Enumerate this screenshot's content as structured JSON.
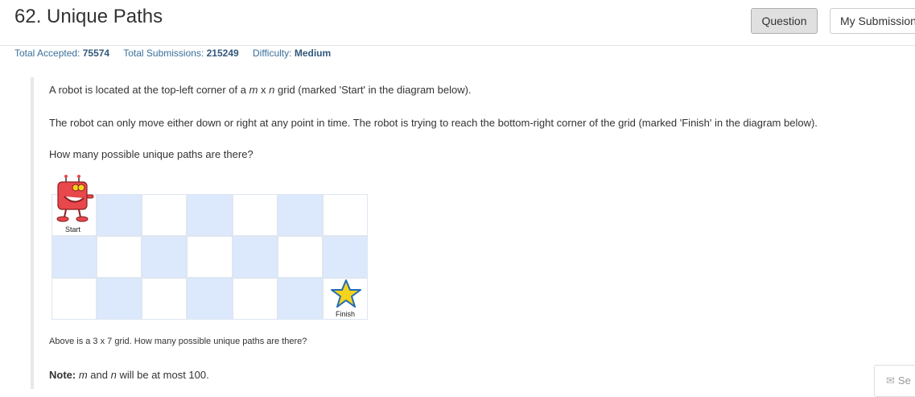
{
  "header": {
    "title": "62. Unique Paths",
    "tabs": [
      {
        "label": "Question",
        "active": true
      },
      {
        "label": "My Submissions",
        "active": false
      }
    ]
  },
  "stats": {
    "accepted_label": "Total Accepted:",
    "accepted_value": "75574",
    "submissions_label": "Total Submissions:",
    "submissions_value": "215249",
    "difficulty_label": "Difficulty:",
    "difficulty_value": "Medium"
  },
  "problem": {
    "p1_a": "A robot is located at the top-left corner of a ",
    "p1_m": "m",
    "p1_x": " x ",
    "p1_n": "n",
    "p1_b": " grid (marked 'Start' in the diagram below).",
    "p2": "The robot can only move either down or right at any point in time. The robot is trying to reach the bottom-right corner of the grid (marked 'Finish' in the diagram below).",
    "p3": "How many possible unique paths are there?",
    "caption": "Above is a 3 x 7 grid. How many possible unique paths are there?",
    "note_label": "Note:",
    "note_m": "m",
    "note_and": " and ",
    "note_n": "n",
    "note_rest": " will be at most 100."
  },
  "diagram": {
    "rows": 3,
    "cols": 7,
    "start_label": "Start",
    "finish_label": "Finish",
    "colors": {
      "blue_cell": "#dce8fb",
      "star": "#f5d31b",
      "star_outline": "#1f6bb5",
      "robot": "#e8474c"
    }
  },
  "footer": {
    "send_label": "Se",
    "send_icon": "envelope-icon"
  }
}
